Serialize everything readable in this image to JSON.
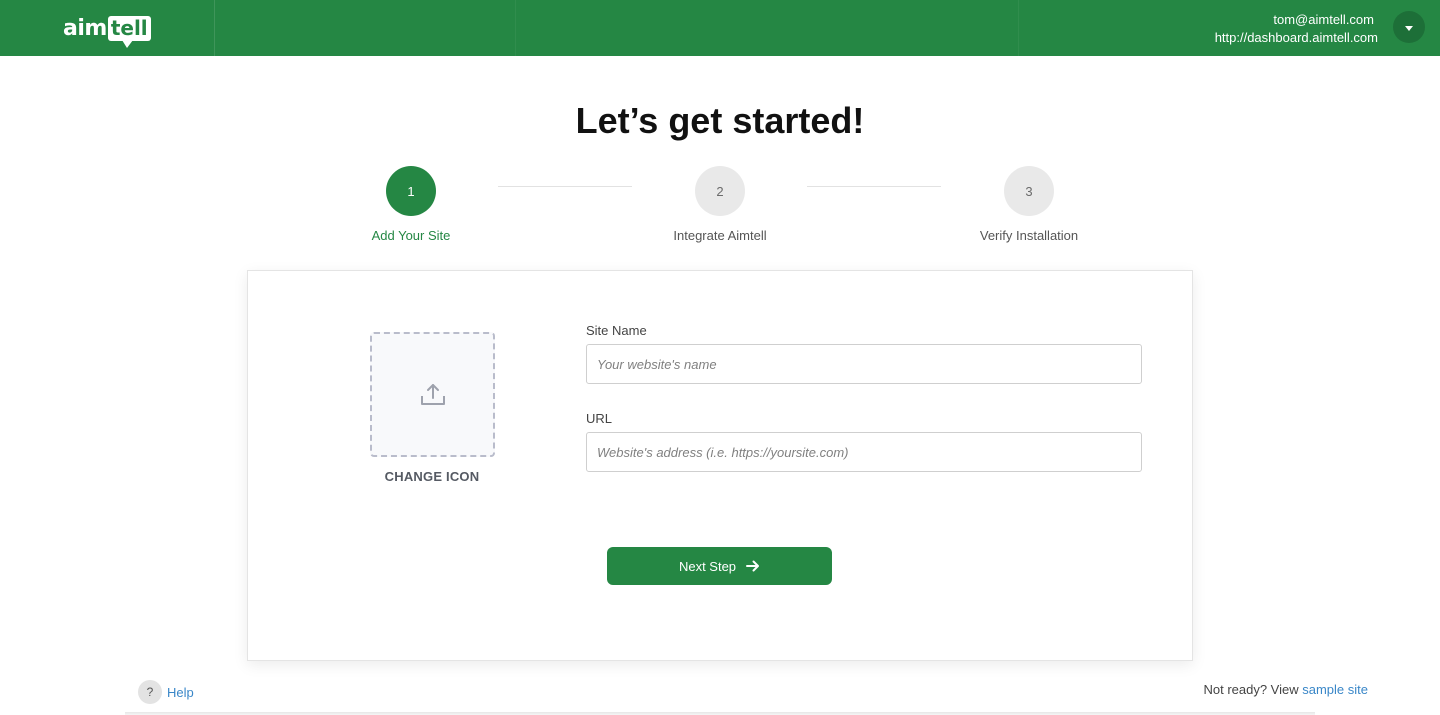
{
  "header": {
    "logo_text_main": "aim",
    "logo_text_bubble": "tell",
    "account_email": "tom@aimtell.com",
    "account_url": "http://dashboard.aimtell.com",
    "brand_color": "#258744"
  },
  "main": {
    "title": "Let’s get started!"
  },
  "steps": [
    {
      "number": "1",
      "label": "Add Your Site",
      "state": "active"
    },
    {
      "number": "2",
      "label": "Integrate Aimtell",
      "state": "inactive"
    },
    {
      "number": "3",
      "label": "Verify Installation",
      "state": "inactive"
    }
  ],
  "form": {
    "change_icon_label": "CHANGE ICON",
    "upload_icon": "upload-icon",
    "site_name_label": "Site Name",
    "site_name_placeholder": "Your website's name",
    "site_name_value": "",
    "url_label": "URL",
    "url_placeholder": "Website's address (i.e. https://yoursite.com)",
    "url_value": "",
    "next_button_label": "Next Step",
    "next_button_icon": "arrow-right-icon"
  },
  "footer": {
    "help_icon": "?",
    "help_label": "Help",
    "not_ready_text": "Not ready? View ",
    "sample_site_link": "sample site"
  }
}
